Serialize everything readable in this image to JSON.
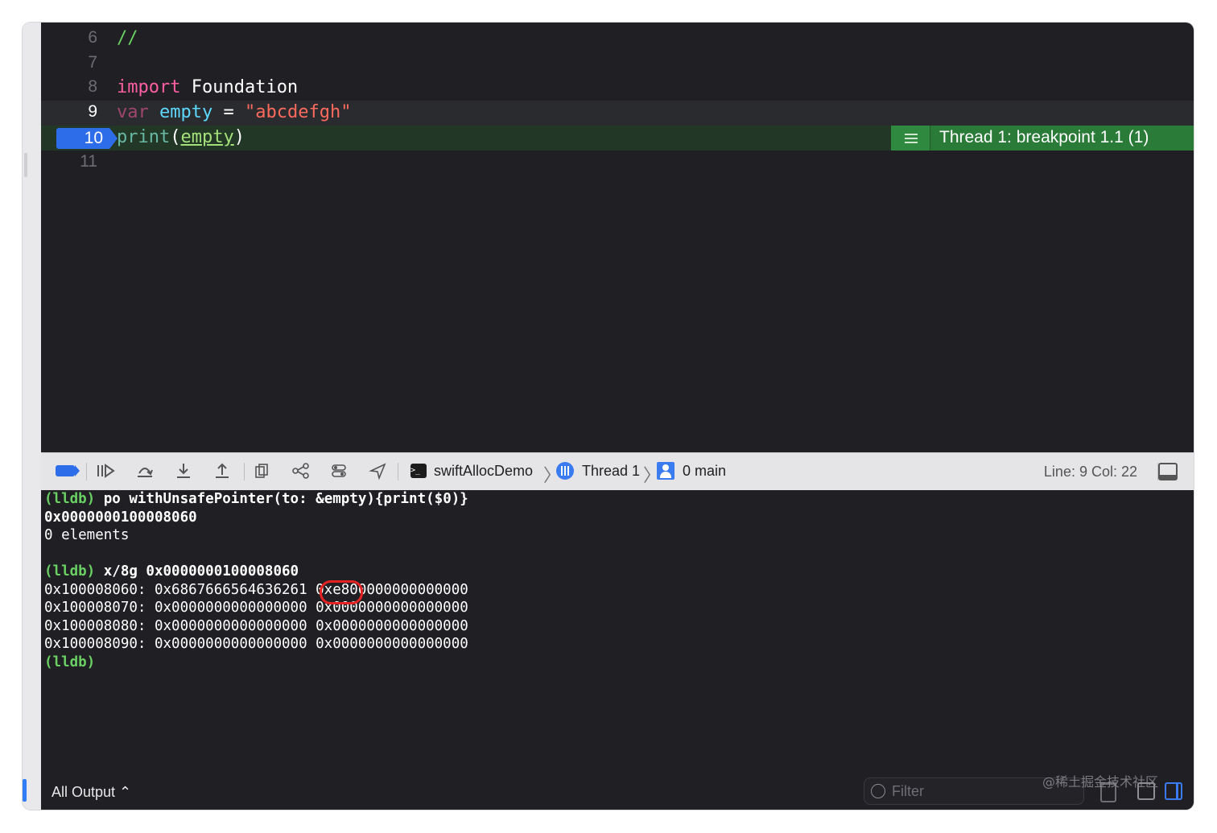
{
  "editor": {
    "lines": [
      {
        "num": "6"
      },
      {
        "num": "7"
      },
      {
        "num": "8"
      },
      {
        "num": "9"
      },
      {
        "num": "10"
      },
      {
        "num": "11"
      }
    ],
    "line6_comment": "//",
    "line8_kw": "import",
    "line8_rest": " Foundation",
    "line9_kw": "var",
    "line9_name": " empty",
    "line9_eq": " = ",
    "line9_str": "\"abcdefgh\"",
    "line10_func": "print",
    "line10_open": "(",
    "line10_arg": "empty",
    "line10_close": ")",
    "annotation": "Thread 1: breakpoint 1.1 (1)"
  },
  "debug_bar": {
    "scheme": "swiftAllocDemo",
    "thread": "Thread 1",
    "frame": "0 main",
    "terminal_glyph": ">_",
    "line_col": "Line: 9  Col: 22"
  },
  "console": {
    "lines": [
      {
        "prompt": "(lldb)",
        "text": " po withUnsafePointer(to: &empty){print($0)}"
      },
      {
        "text": "0x0000000100008060"
      },
      {
        "text": "0 elements"
      },
      {
        "text": ""
      },
      {
        "prompt": "(lldb)",
        "text": " x/8g 0x0000000100008060"
      },
      {
        "text": "0x100008060: 0x6867666564636261 0xe800000000000000"
      },
      {
        "text": "0x100008070: 0x0000000000000000 0x0000000000000000"
      },
      {
        "text": "0x100008080: 0x0000000000000000 0x0000000000000000"
      },
      {
        "text": "0x100008090: 0x0000000000000000 0x0000000000000000"
      },
      {
        "prompt": "(lldb)",
        "text": ""
      }
    ],
    "output_selector": "All Output ⌃",
    "filter_placeholder": "Filter"
  },
  "watermark": "@稀土掘金技术社区",
  "colors": {
    "editor_bg": "#1f1f24",
    "keyword": "#fc5fa3",
    "string": "#fc6a5d",
    "comment": "#6bd064",
    "breakpoint": "#2d6dea",
    "annotation_green": "#2a7a38",
    "prompt_green": "#6bd064",
    "highlight_red": "#e52222"
  },
  "icons": [
    "breakpoints-toggle-icon",
    "continue-icon",
    "step-over-icon",
    "step-into-icon",
    "step-out-icon",
    "debug-view-hierarchy-icon",
    "memory-graph-icon",
    "environment-overrides-icon",
    "simulate-location-icon",
    "terminal-icon",
    "thread-icon",
    "person-icon",
    "panel-toggle-icon",
    "filter-icon",
    "trash-icon",
    "split-left-icon",
    "split-right-icon"
  ]
}
